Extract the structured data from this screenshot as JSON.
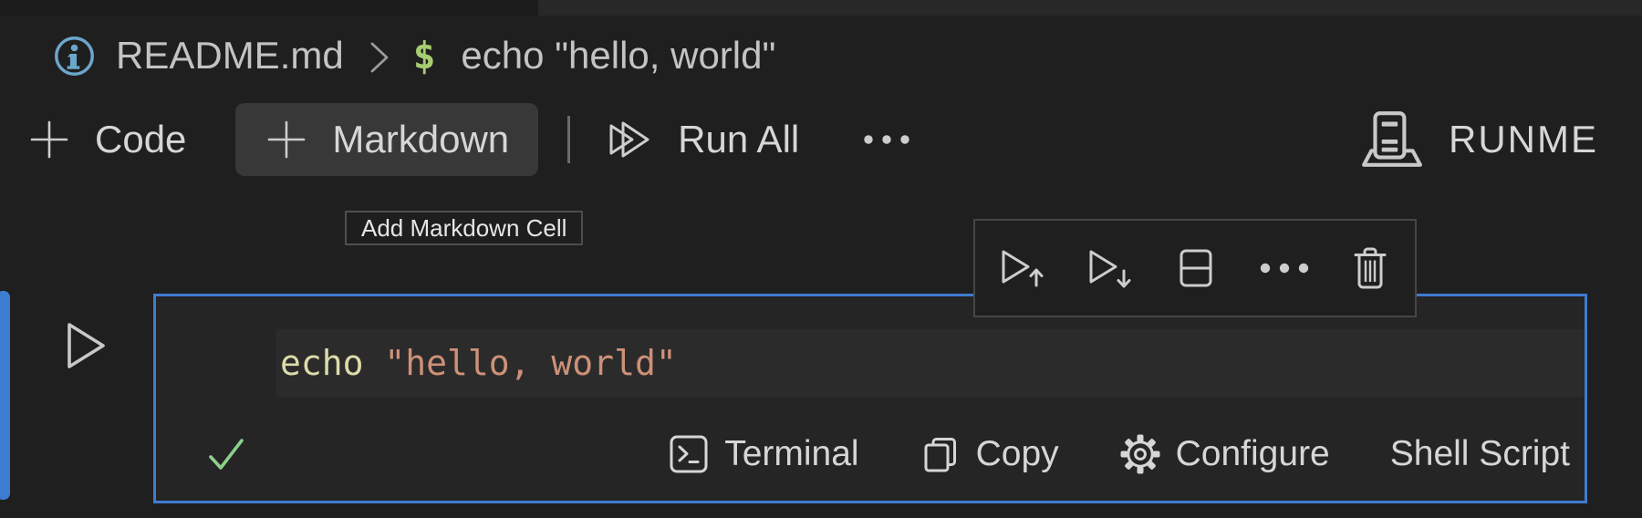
{
  "breadcrumb": {
    "file": "README.md",
    "prompt": "$",
    "command": "echo \"hello, world\""
  },
  "notebook_toolbar": {
    "code_label": "Code",
    "markdown_label": "Markdown",
    "run_all_label": "Run All",
    "kernel_label": "RUNME"
  },
  "tooltip": {
    "text": "Add Markdown Cell"
  },
  "cell": {
    "code": {
      "keyword": "echo",
      "space": " ",
      "string": "\"hello, world\""
    },
    "status": {
      "terminal_label": "Terminal",
      "copy_label": "Copy",
      "configure_label": "Configure",
      "language_label": "Shell Script"
    }
  },
  "icons": [
    "info-icon",
    "chevron-right-icon",
    "plus-icon",
    "run-all-icon",
    "ellipsis-icon",
    "runme-logo-icon",
    "execute-above-icon",
    "execute-below-icon",
    "split-cell-icon",
    "more-actions-icon",
    "trash-icon",
    "run-cell-icon",
    "check-icon",
    "terminal-icon",
    "copy-icon",
    "gear-icon"
  ],
  "colors": {
    "page_bg": "#1f1f1f",
    "tab_strip_bg": "#282828",
    "cell_bg": "#252526",
    "line_highlight": "#2b2b2b",
    "focus_blue": "#3e7cd0",
    "hover_bg": "#383838",
    "text": "#d6d6d6",
    "keyword_yellow": "#dcdcaa",
    "string_salmon": "#ce9178",
    "dollar_green": "#a6ce70",
    "info_blue": "#6ba7cb",
    "check_green": "#8dd08b",
    "tooltip_border": "#4e4e4e"
  }
}
